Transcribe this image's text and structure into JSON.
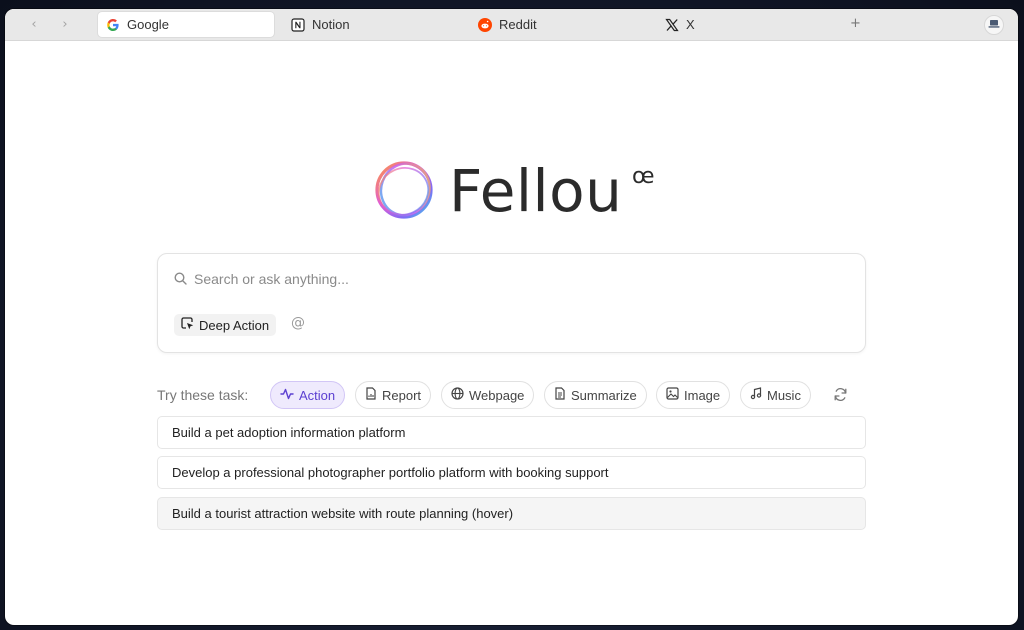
{
  "browser": {
    "nav": {
      "back": "‹",
      "forward": "›"
    },
    "tabs": [
      {
        "label": "Google",
        "icon": "google-icon",
        "active": true
      },
      {
        "label": "Notion",
        "icon": "notion-icon",
        "active": false
      },
      {
        "label": "Reddit",
        "icon": "reddit-icon",
        "active": false
      },
      {
        "label": "X",
        "icon": "x-icon",
        "active": false
      }
    ],
    "new_tab": "+"
  },
  "logo": {
    "wordmark": "Fellou",
    "mark": "œ"
  },
  "search": {
    "placeholder": "Search or ask anything...",
    "value": ""
  },
  "deep_action": {
    "label": "Deep Action"
  },
  "at_symbol": "@",
  "tasks": {
    "label": "Try these task:",
    "chips": [
      {
        "label": "Action",
        "icon": "activity-icon",
        "active": true
      },
      {
        "label": "Report",
        "icon": "report-icon",
        "active": false
      },
      {
        "label": "Webpage",
        "icon": "globe-icon",
        "active": false
      },
      {
        "label": "Summarize",
        "icon": "document-icon",
        "active": false
      },
      {
        "label": "Image",
        "icon": "image-icon",
        "active": false
      },
      {
        "label": "Music",
        "icon": "music-icon",
        "active": false
      }
    ],
    "refresh_icon": "refresh-icon"
  },
  "suggestions": [
    {
      "text": "Build a pet adoption information platform",
      "hover": false
    },
    {
      "text": "Develop a professional photographer portfolio platform with booking support",
      "hover": false
    },
    {
      "text": "Build a tourist attraction website with route planning (hover)",
      "hover": true
    }
  ],
  "colors": {
    "accent": "#5b3fd1",
    "accent_bg": "#efeafd",
    "reddit": "#ff4500",
    "google_blue": "#4285f4"
  }
}
